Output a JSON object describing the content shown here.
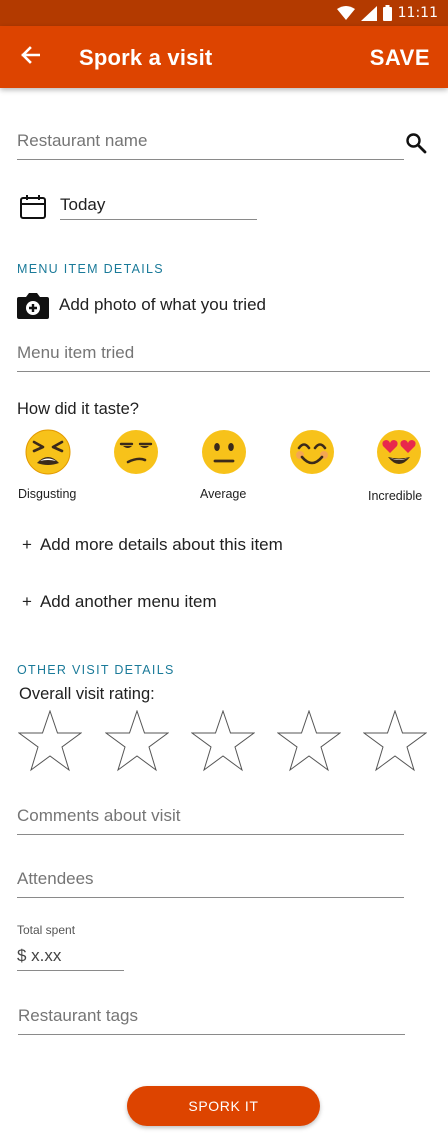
{
  "status_bar": {
    "time": "11:11"
  },
  "app_bar": {
    "title": "Spork a visit",
    "save_label": "SAVE"
  },
  "restaurant": {
    "placeholder": "Restaurant name"
  },
  "date": {
    "value": "Today"
  },
  "menu_section": {
    "heading": "MENU ITEM DETAILS",
    "add_photo_label": "Add photo of what you tried",
    "item_placeholder": "Menu item tried",
    "taste_question": "How did it taste?",
    "taste_options": [
      {
        "icon": "tired-face-icon"
      },
      {
        "icon": "unamused-face-icon"
      },
      {
        "icon": "neutral-face-icon"
      },
      {
        "icon": "smiling-face-icon"
      },
      {
        "icon": "heart-eyes-face-icon"
      }
    ],
    "scale_labels": {
      "low": "Disgusting",
      "mid": "Average",
      "high": "Incredible"
    },
    "add_details_label": "Add more details about this item",
    "add_item_label": "Add another menu item",
    "plus_symbol": "+"
  },
  "visit_section": {
    "heading": "OTHER VISIT DETAILS",
    "rating_label": "Overall visit rating:",
    "rating_stars": 5,
    "rating_value": 0,
    "comments_placeholder": "Comments about visit",
    "attendees_placeholder": "Attendees",
    "total_label": "Total spent",
    "total_placeholder": "$ x.xx",
    "tags_placeholder": "Restaurant tags"
  },
  "submit_label": "SPORK IT",
  "colors": {
    "primary": "#dd4400",
    "status_bar": "#b33a00",
    "section_heading": "#1a7a99"
  }
}
